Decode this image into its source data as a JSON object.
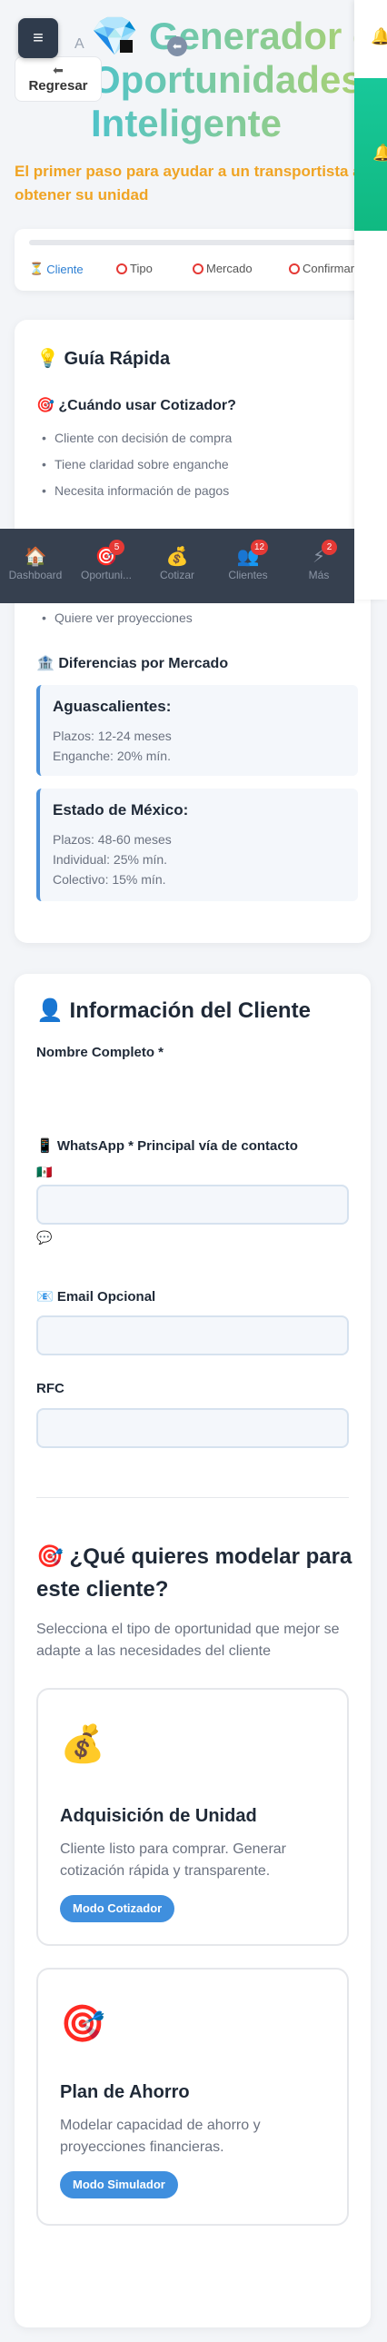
{
  "header": {
    "menu_icon": "≡",
    "back_label": "Regresar",
    "back_arrow": "⬅",
    "ghost_letter": "A",
    "circle_back": "⬅",
    "title_gem": "💎",
    "title_lines": [
      "Generador de",
      "Oportunidades",
      "Inteligente"
    ],
    "subtitle": "El primer paso para ayudar a un transportista a obtener su unidad",
    "bell_icon": "🔔"
  },
  "steps": [
    {
      "icon": "⏳",
      "label": "Cliente",
      "active": true
    },
    {
      "label": "Tipo"
    },
    {
      "label": "Mercado"
    },
    {
      "label": "Confirmar"
    }
  ],
  "guide": {
    "title": "💡 Guía Rápida",
    "when_title": "🎯 ¿Cuándo usar Cotizador?",
    "when_items": [
      "Cliente con decisión de compra",
      "Tiene claridad sobre enganche",
      "Necesita información de pagos"
    ],
    "sim_item": "Quiere ver proyecciones",
    "markets_title": "🏦 Diferencias por Mercado",
    "markets": [
      {
        "name": "Aguascalientes:",
        "lines": [
          "Plazos: 12-24 meses",
          "Enganche: 20% mín."
        ]
      },
      {
        "name": "Estado de México:",
        "lines": [
          "Plazos: 48-60 meses",
          "Individual: 25% mín.",
          "Colectivo: 15% mín."
        ]
      }
    ]
  },
  "nav": [
    {
      "icon": "🏠",
      "label": "Dashboard"
    },
    {
      "icon": "🎯",
      "label": "Oportuni...",
      "badge": "5"
    },
    {
      "icon": "💰",
      "label": "Cotizar"
    },
    {
      "icon": "👥",
      "label": "Clientes",
      "badge": "12"
    },
    {
      "icon": "⚡",
      "label": "Más",
      "badge": "2"
    }
  ],
  "client": {
    "title": "👤 Información del Cliente",
    "name_label": "Nombre Completo *",
    "whatsapp_label": "📱 WhatsApp * Principal vía de contacto",
    "flag": "🇲🇽",
    "chat_icon": "💬",
    "email_label": "📧 Email Opcional",
    "rfc_label": "RFC"
  },
  "model": {
    "title": "🎯 ¿Qué quieres modelar para este cliente?",
    "desc": "Selecciona el tipo de oportunidad que mejor se adapte a las necesidades del cliente",
    "options": [
      {
        "emoji": "💰",
        "title": "Adquisición de Unidad",
        "desc": "Cliente listo para comprar. Generar cotización rápida y transparente.",
        "button": "Modo Cotizador"
      },
      {
        "emoji": "🎯",
        "title": "Plan de Ahorro",
        "desc": "Modelar capacidad de ahorro y proyecciones financieras.",
        "button": "Modo Simulador"
      }
    ]
  }
}
